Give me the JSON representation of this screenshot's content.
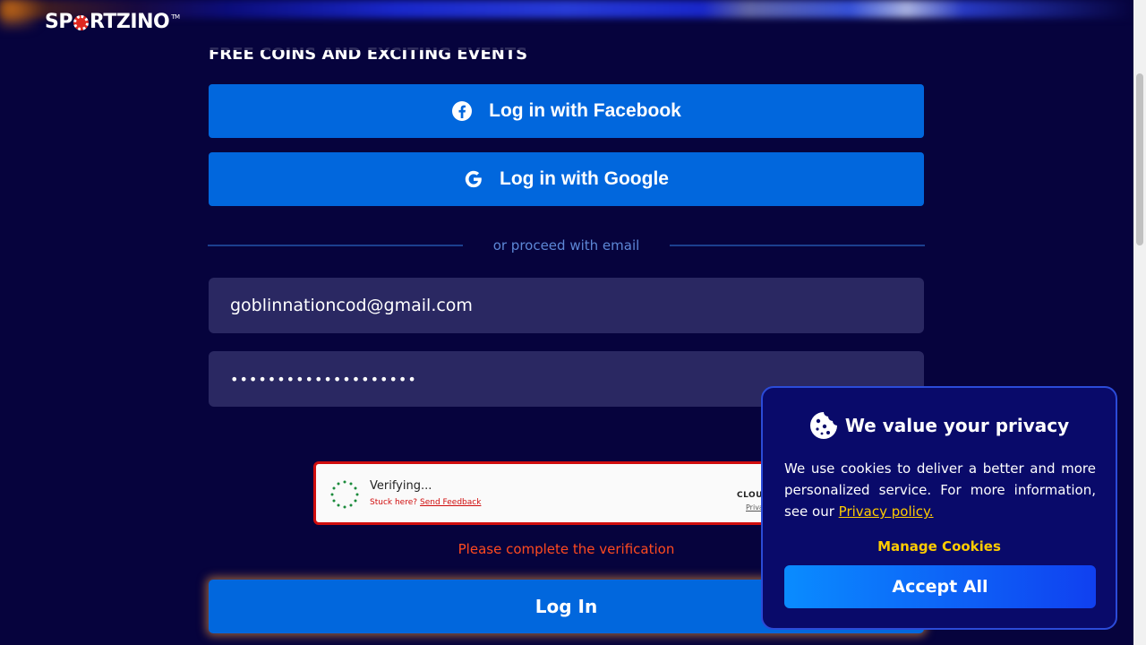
{
  "brand": {
    "name_prefix": "SP",
    "name_suffix": "RTZINO",
    "trademark": "TM"
  },
  "tagline": "FREE COINS AND EXCITING EVENTS DAILY!",
  "social": {
    "facebook_label": "Log in with Facebook",
    "google_label": "Log in with Google"
  },
  "divider_text": "or proceed with email",
  "form": {
    "email_value": "goblinnationcod@gmail.com",
    "password_value": "••••••••••••••••••••"
  },
  "captcha": {
    "status": "Verifying...",
    "stuck": "Stuck here?",
    "feedback_link": "Send Feedback",
    "brand": "CLOU",
    "privacy": "Priva"
  },
  "error_text": "Please complete the verification",
  "login_label": "Log In",
  "cookie": {
    "title": "We value your privacy",
    "body": "We use cookies to deliver a better and more personalized service. For more information, see our ",
    "privacy_link": "Privacy policy.",
    "manage_label": "Manage Cookies",
    "accept_label": "Accept All"
  },
  "colors": {
    "background": "#06033d",
    "primary_button": "#0167dd",
    "field_bg": "#2a2862",
    "error": "#ff4a1f",
    "accent_yellow": "#ffcc00"
  }
}
